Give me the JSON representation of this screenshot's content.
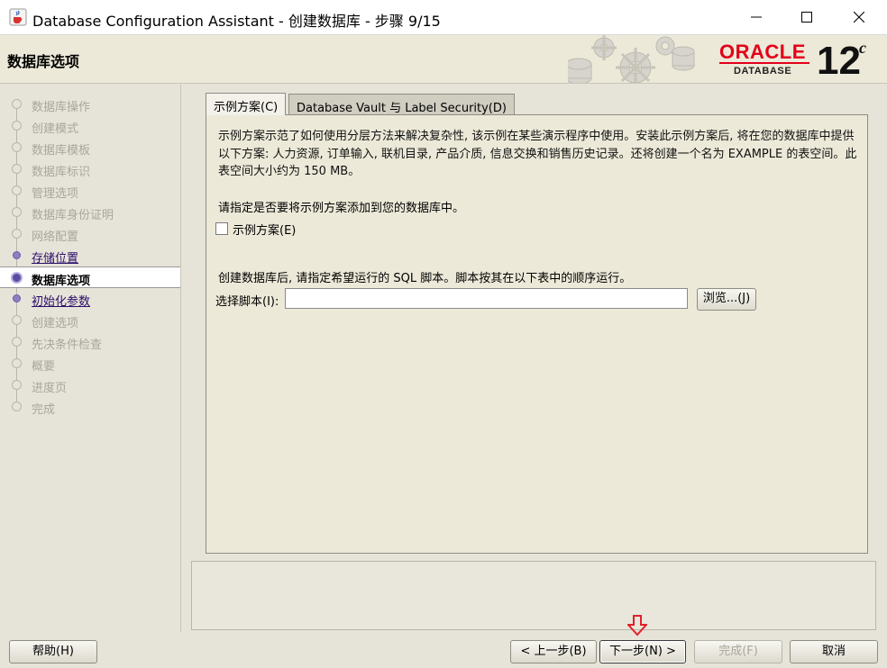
{
  "window": {
    "title": "Database Configuration Assistant - 创建数据库 - 步骤 9/15",
    "icon": "java-coffee-cup-icon"
  },
  "header": {
    "page_title": "数据库选项",
    "logo_word": "ORACLE",
    "logo_sub": "DATABASE",
    "version": "12",
    "version_suffix": "c"
  },
  "sidebar": {
    "steps": [
      {
        "label": "数据库操作",
        "state": "disabled"
      },
      {
        "label": "创建模式",
        "state": "disabled"
      },
      {
        "label": "数据库模板",
        "state": "disabled"
      },
      {
        "label": "数据库标识",
        "state": "disabled"
      },
      {
        "label": "管理选项",
        "state": "disabled"
      },
      {
        "label": "数据库身份证明",
        "state": "disabled"
      },
      {
        "label": "网络配置",
        "state": "disabled"
      },
      {
        "label": "存储位置",
        "state": "link"
      },
      {
        "label": "数据库选项",
        "state": "current"
      },
      {
        "label": "初始化参数",
        "state": "link"
      },
      {
        "label": "创建选项",
        "state": "disabled"
      },
      {
        "label": "先决条件检查",
        "state": "disabled"
      },
      {
        "label": "概要",
        "state": "disabled"
      },
      {
        "label": "进度页",
        "state": "disabled"
      },
      {
        "label": "完成",
        "state": "disabled"
      }
    ]
  },
  "tabs": [
    {
      "label": "示例方案(C)",
      "active": true
    },
    {
      "label": "Database Vault 与 Label Security(D)",
      "active": false
    }
  ],
  "sample_schemas": {
    "description": "示例方案示范了如何使用分层方法来解决复杂性, 该示例在某些演示程序中使用。安装此示例方案后, 将在您的数据库中提供以下方案: 人力资源, 订单输入, 联机目录, 产品介质, 信息交换和销售历史记录。还将创建一个名为 EXAMPLE 的表空间。此表空间大小约为 150 MB。",
    "prompt": "请指定是否要将示例方案添加到您的数据库中。",
    "checkbox_label": "示例方案(E)",
    "checkbox_checked": false,
    "sql_note": "创建数据库后, 请指定希望运行的 SQL 脚本。脚本按其在以下表中的顺序运行。",
    "script_label": "选择脚本(I):",
    "script_value": "",
    "browse_label": "浏览...(J)"
  },
  "footer": {
    "help": "帮助(H)",
    "back": "< 上一步(B)",
    "next": "下一步(N) >",
    "finish": "完成(F)",
    "cancel": "取消"
  },
  "colors": {
    "oracle_red": "#e2001a",
    "link": "#2a0d6b",
    "annotation_arrow": "#e0202a"
  }
}
